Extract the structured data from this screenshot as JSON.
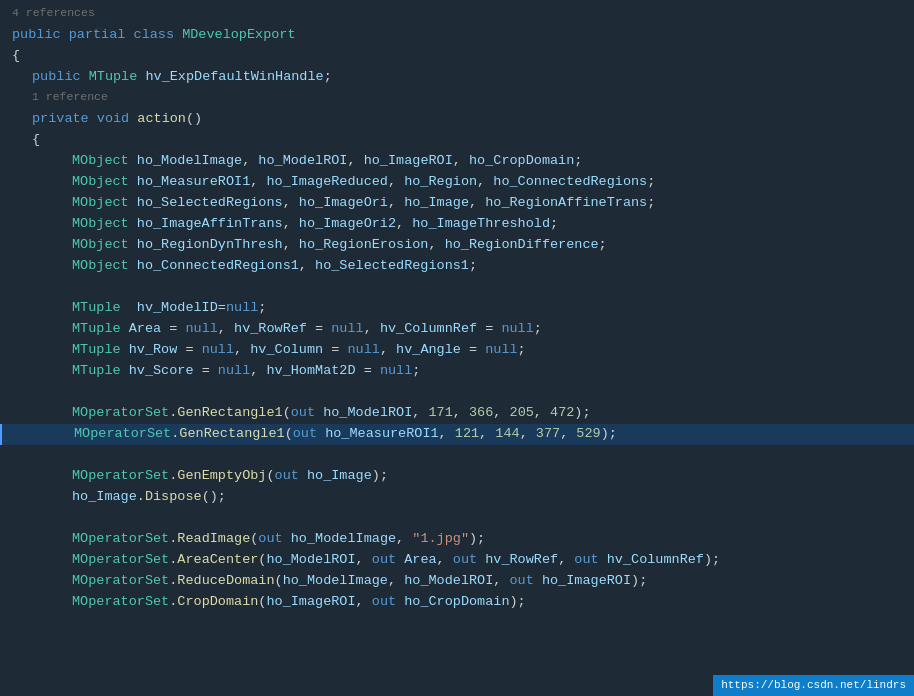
{
  "lines": [
    {
      "id": "l1",
      "indent": "none",
      "tokens": [
        {
          "t": "4 references",
          "c": "ref-hint"
        }
      ],
      "highlight": false
    },
    {
      "id": "l2",
      "indent": "none",
      "tokens": [
        {
          "t": "public ",
          "c": "kw"
        },
        {
          "t": "partial ",
          "c": "kw"
        },
        {
          "t": "class ",
          "c": "kw"
        },
        {
          "t": "MDevelopExport",
          "c": "classname"
        }
      ],
      "highlight": false
    },
    {
      "id": "l3",
      "indent": "none",
      "tokens": [
        {
          "t": "{",
          "c": "plain"
        }
      ],
      "highlight": false
    },
    {
      "id": "l4",
      "indent": "indent1",
      "tokens": [
        {
          "t": "public ",
          "c": "kw"
        },
        {
          "t": "MTuple ",
          "c": "type"
        },
        {
          "t": "hv_ExpDefaultWinHandle",
          "c": "var"
        },
        {
          "t": ";",
          "c": "plain"
        }
      ],
      "highlight": false
    },
    {
      "id": "l5",
      "indent": "indent1",
      "tokens": [
        {
          "t": "1 reference",
          "c": "ref-hint"
        }
      ],
      "highlight": false
    },
    {
      "id": "l6",
      "indent": "indent1",
      "tokens": [
        {
          "t": "private ",
          "c": "kw"
        },
        {
          "t": "void ",
          "c": "kw"
        },
        {
          "t": "action",
          "c": "method"
        },
        {
          "t": "()",
          "c": "plain"
        }
      ],
      "highlight": false
    },
    {
      "id": "l7",
      "indent": "indent1",
      "tokens": [
        {
          "t": "{",
          "c": "plain"
        }
      ],
      "highlight": false
    },
    {
      "id": "l8",
      "indent": "indent2",
      "tokens": [
        {
          "t": "MObject ",
          "c": "type"
        },
        {
          "t": "ho_ModelImage",
          "c": "var"
        },
        {
          "t": ", ",
          "c": "plain"
        },
        {
          "t": "ho_ModelROI",
          "c": "var"
        },
        {
          "t": ", ",
          "c": "plain"
        },
        {
          "t": "ho_ImageROI",
          "c": "var"
        },
        {
          "t": ", ",
          "c": "plain"
        },
        {
          "t": "ho_CropDomain",
          "c": "var"
        },
        {
          "t": ";",
          "c": "plain"
        }
      ],
      "highlight": false
    },
    {
      "id": "l9",
      "indent": "indent2",
      "tokens": [
        {
          "t": "MObject ",
          "c": "type"
        },
        {
          "t": "ho_MeasureROI1",
          "c": "var"
        },
        {
          "t": ", ",
          "c": "plain"
        },
        {
          "t": "ho_ImageReduced",
          "c": "var"
        },
        {
          "t": ", ",
          "c": "plain"
        },
        {
          "t": "ho_Region",
          "c": "var"
        },
        {
          "t": ", ",
          "c": "plain"
        },
        {
          "t": "ho_ConnectedRegions",
          "c": "var"
        },
        {
          "t": ";",
          "c": "plain"
        }
      ],
      "highlight": false
    },
    {
      "id": "l10",
      "indent": "indent2",
      "tokens": [
        {
          "t": "MObject ",
          "c": "type"
        },
        {
          "t": "ho_SelectedRegions",
          "c": "var"
        },
        {
          "t": ", ",
          "c": "plain"
        },
        {
          "t": "ho_ImageOri",
          "c": "var"
        },
        {
          "t": ", ",
          "c": "plain"
        },
        {
          "t": "ho_Image",
          "c": "var"
        },
        {
          "t": ", ",
          "c": "plain"
        },
        {
          "t": "ho_RegionAffineTrans",
          "c": "var"
        },
        {
          "t": ";",
          "c": "plain"
        }
      ],
      "highlight": false
    },
    {
      "id": "l11",
      "indent": "indent2",
      "tokens": [
        {
          "t": "MObject ",
          "c": "type"
        },
        {
          "t": "ho_ImageAffinTrans",
          "c": "var"
        },
        {
          "t": ", ",
          "c": "plain"
        },
        {
          "t": "ho_ImageOri2",
          "c": "var"
        },
        {
          "t": ", ",
          "c": "plain"
        },
        {
          "t": "ho_ImageThreshold",
          "c": "var"
        },
        {
          "t": ";",
          "c": "plain"
        }
      ],
      "highlight": false
    },
    {
      "id": "l12",
      "indent": "indent2",
      "tokens": [
        {
          "t": "MObject ",
          "c": "type"
        },
        {
          "t": "ho_RegionDynThresh",
          "c": "var"
        },
        {
          "t": ", ",
          "c": "plain"
        },
        {
          "t": "ho_RegionErosion",
          "c": "var"
        },
        {
          "t": ", ",
          "c": "plain"
        },
        {
          "t": "ho_RegionDifference",
          "c": "var"
        },
        {
          "t": ";",
          "c": "plain"
        }
      ],
      "highlight": false
    },
    {
      "id": "l13",
      "indent": "indent2",
      "tokens": [
        {
          "t": "MObject ",
          "c": "type"
        },
        {
          "t": "ho_ConnectedRegions1",
          "c": "var"
        },
        {
          "t": ", ",
          "c": "plain"
        },
        {
          "t": "ho_SelectedRegions1",
          "c": "var"
        },
        {
          "t": ";",
          "c": "plain"
        }
      ],
      "highlight": false
    },
    {
      "id": "l14",
      "indent": "none",
      "tokens": [
        {
          "t": "",
          "c": "plain"
        }
      ],
      "highlight": false
    },
    {
      "id": "l15",
      "indent": "indent2",
      "tokens": [
        {
          "t": "MTuple  ",
          "c": "type"
        },
        {
          "t": "hv_ModelID",
          "c": "var"
        },
        {
          "t": "=",
          "c": "plain"
        },
        {
          "t": "null",
          "c": "kw"
        },
        {
          "t": ";",
          "c": "plain"
        }
      ],
      "highlight": false
    },
    {
      "id": "l16",
      "indent": "indent2",
      "tokens": [
        {
          "t": "MTuple ",
          "c": "type"
        },
        {
          "t": "Area ",
          "c": "var"
        },
        {
          "t": "= ",
          "c": "plain"
        },
        {
          "t": "null",
          "c": "kw"
        },
        {
          "t": ", ",
          "c": "plain"
        },
        {
          "t": "hv_RowRef ",
          "c": "var"
        },
        {
          "t": "= ",
          "c": "plain"
        },
        {
          "t": "null",
          "c": "kw"
        },
        {
          "t": ", ",
          "c": "plain"
        },
        {
          "t": "hv_ColumnRef ",
          "c": "var"
        },
        {
          "t": "= ",
          "c": "plain"
        },
        {
          "t": "null",
          "c": "kw"
        },
        {
          "t": ";",
          "c": "plain"
        }
      ],
      "highlight": false
    },
    {
      "id": "l17",
      "indent": "indent2",
      "tokens": [
        {
          "t": "MTuple ",
          "c": "type"
        },
        {
          "t": "hv_Row ",
          "c": "var"
        },
        {
          "t": "= ",
          "c": "plain"
        },
        {
          "t": "null",
          "c": "kw"
        },
        {
          "t": ", ",
          "c": "plain"
        },
        {
          "t": "hv_Column ",
          "c": "var"
        },
        {
          "t": "= ",
          "c": "plain"
        },
        {
          "t": "null",
          "c": "kw"
        },
        {
          "t": ", ",
          "c": "plain"
        },
        {
          "t": "hv_Angle ",
          "c": "var"
        },
        {
          "t": "= ",
          "c": "plain"
        },
        {
          "t": "null",
          "c": "kw"
        },
        {
          "t": ";",
          "c": "plain"
        }
      ],
      "highlight": false
    },
    {
      "id": "l18",
      "indent": "indent2",
      "tokens": [
        {
          "t": "MTuple ",
          "c": "type"
        },
        {
          "t": "hv_Score ",
          "c": "var"
        },
        {
          "t": "= ",
          "c": "plain"
        },
        {
          "t": "null",
          "c": "kw"
        },
        {
          "t": ", ",
          "c": "plain"
        },
        {
          "t": "hv_HomMat2D ",
          "c": "var"
        },
        {
          "t": "= ",
          "c": "plain"
        },
        {
          "t": "null",
          "c": "kw"
        },
        {
          "t": ";",
          "c": "plain"
        }
      ],
      "highlight": false
    },
    {
      "id": "l19",
      "indent": "none",
      "tokens": [
        {
          "t": "",
          "c": "plain"
        }
      ],
      "highlight": false
    },
    {
      "id": "l20",
      "indent": "indent2",
      "tokens": [
        {
          "t": "MOperatorSet",
          "c": "type"
        },
        {
          "t": ".",
          "c": "plain"
        },
        {
          "t": "GenRectangle1",
          "c": "method"
        },
        {
          "t": "(",
          "c": "plain"
        },
        {
          "t": "out ",
          "c": "kw"
        },
        {
          "t": "ho_ModelROI",
          "c": "var"
        },
        {
          "t": ", ",
          "c": "plain"
        },
        {
          "t": "171",
          "c": "num"
        },
        {
          "t": ", ",
          "c": "plain"
        },
        {
          "t": "366",
          "c": "num"
        },
        {
          "t": ", ",
          "c": "plain"
        },
        {
          "t": "205",
          "c": "num"
        },
        {
          "t": ", ",
          "c": "plain"
        },
        {
          "t": "472",
          "c": "num"
        },
        {
          "t": ");",
          "c": "plain"
        }
      ],
      "highlight": false
    },
    {
      "id": "l21",
      "indent": "indent2",
      "tokens": [
        {
          "t": "MOperatorSet",
          "c": "type"
        },
        {
          "t": ".",
          "c": "plain"
        },
        {
          "t": "GenRectangle1",
          "c": "method"
        },
        {
          "t": "(",
          "c": "plain"
        },
        {
          "t": "out ",
          "c": "kw"
        },
        {
          "t": "ho_MeasureROI1",
          "c": "var"
        },
        {
          "t": ", ",
          "c": "plain"
        },
        {
          "t": "121",
          "c": "num"
        },
        {
          "t": ", ",
          "c": "plain"
        },
        {
          "t": "144",
          "c": "num"
        },
        {
          "t": ", ",
          "c": "plain"
        },
        {
          "t": "377",
          "c": "num"
        },
        {
          "t": ", ",
          "c": "plain"
        },
        {
          "t": "529",
          "c": "num"
        },
        {
          "t": ");",
          "c": "plain"
        }
      ],
      "highlight": true
    },
    {
      "id": "l22",
      "indent": "none",
      "tokens": [
        {
          "t": "",
          "c": "plain"
        }
      ],
      "highlight": false
    },
    {
      "id": "l23",
      "indent": "indent2",
      "tokens": [
        {
          "t": "MOperatorSet",
          "c": "type"
        },
        {
          "t": ".",
          "c": "plain"
        },
        {
          "t": "GenEmptyObj",
          "c": "method"
        },
        {
          "t": "(",
          "c": "plain"
        },
        {
          "t": "out ",
          "c": "kw"
        },
        {
          "t": "ho_Image",
          "c": "var"
        },
        {
          "t": ");",
          "c": "plain"
        }
      ],
      "highlight": false
    },
    {
      "id": "l24",
      "indent": "indent2",
      "tokens": [
        {
          "t": "ho_Image",
          "c": "var"
        },
        {
          "t": ".",
          "c": "plain"
        },
        {
          "t": "Dispose",
          "c": "method"
        },
        {
          "t": "();",
          "c": "plain"
        }
      ],
      "highlight": false
    },
    {
      "id": "l25",
      "indent": "none",
      "tokens": [
        {
          "t": "",
          "c": "plain"
        }
      ],
      "highlight": false
    },
    {
      "id": "l26",
      "indent": "indent2",
      "tokens": [
        {
          "t": "MOperatorSet",
          "c": "type"
        },
        {
          "t": ".",
          "c": "plain"
        },
        {
          "t": "ReadImage",
          "c": "method"
        },
        {
          "t": "(",
          "c": "plain"
        },
        {
          "t": "out ",
          "c": "kw"
        },
        {
          "t": "ho_ModelImage",
          "c": "var"
        },
        {
          "t": ", ",
          "c": "plain"
        },
        {
          "t": "\"1.jpg\"",
          "c": "str"
        },
        {
          "t": ");",
          "c": "plain"
        }
      ],
      "highlight": false
    },
    {
      "id": "l27",
      "indent": "indent2",
      "tokens": [
        {
          "t": "MOperatorSet",
          "c": "type"
        },
        {
          "t": ".",
          "c": "plain"
        },
        {
          "t": "AreaCenter",
          "c": "method"
        },
        {
          "t": "(",
          "c": "plain"
        },
        {
          "t": "ho_ModelROI",
          "c": "var"
        },
        {
          "t": ", ",
          "c": "plain"
        },
        {
          "t": "out ",
          "c": "kw"
        },
        {
          "t": "Area",
          "c": "var"
        },
        {
          "t": ", ",
          "c": "plain"
        },
        {
          "t": "out ",
          "c": "kw"
        },
        {
          "t": "hv_RowRef",
          "c": "var"
        },
        {
          "t": ", ",
          "c": "plain"
        },
        {
          "t": "out ",
          "c": "kw"
        },
        {
          "t": "hv_ColumnRef",
          "c": "var"
        },
        {
          "t": ");",
          "c": "plain"
        }
      ],
      "highlight": false
    },
    {
      "id": "l28",
      "indent": "indent2",
      "tokens": [
        {
          "t": "MOperatorSet",
          "c": "type"
        },
        {
          "t": ".",
          "c": "plain"
        },
        {
          "t": "ReduceDomain",
          "c": "method"
        },
        {
          "t": "(",
          "c": "plain"
        },
        {
          "t": "ho_ModelImage",
          "c": "var"
        },
        {
          "t": ", ",
          "c": "plain"
        },
        {
          "t": "ho_ModelROI",
          "c": "var"
        },
        {
          "t": ", ",
          "c": "plain"
        },
        {
          "t": "out ",
          "c": "kw"
        },
        {
          "t": "ho_ImageROI",
          "c": "var"
        },
        {
          "t": ");",
          "c": "plain"
        }
      ],
      "highlight": false
    },
    {
      "id": "l29",
      "indent": "indent2",
      "tokens": [
        {
          "t": "MOperatorSet",
          "c": "type"
        },
        {
          "t": ".",
          "c": "plain"
        },
        {
          "t": "CropDomain",
          "c": "method"
        },
        {
          "t": "(",
          "c": "plain"
        },
        {
          "t": "ho_ImageROI",
          "c": "var"
        },
        {
          "t": ", ",
          "c": "plain"
        },
        {
          "t": "out ",
          "c": "kw"
        },
        {
          "t": "ho_CropDomain",
          "c": "var"
        },
        {
          "t": ");",
          "c": "plain"
        }
      ],
      "highlight": false
    }
  ],
  "url": "https://blog.csdn.net/lindrs"
}
